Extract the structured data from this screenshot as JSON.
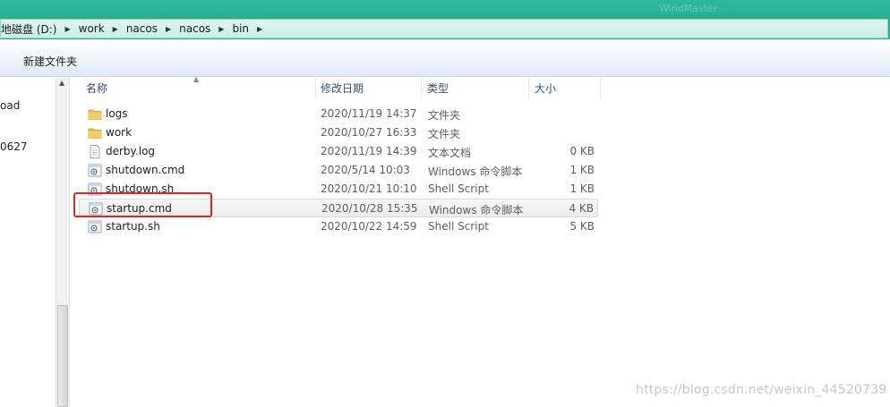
{
  "titlebar": {
    "ghost_text": "WindMaster"
  },
  "address": {
    "crumbs": [
      {
        "label": "地磁盘 (D:)"
      },
      {
        "label": "work"
      },
      {
        "label": "nacos"
      },
      {
        "label": "nacos"
      },
      {
        "label": "bin"
      }
    ]
  },
  "toolbar": {
    "new_folder_label": "新建文件夹"
  },
  "nav": {
    "items": [
      {
        "label": "oad"
      },
      {
        "label": "0627"
      }
    ]
  },
  "columns": {
    "name": "名称",
    "date": "修改日期",
    "type": "类型",
    "size": "大小"
  },
  "files": [
    {
      "name": "logs",
      "date": "2020/11/19 14:37",
      "type": "文件夹",
      "size": "",
      "icon": "folder-icon"
    },
    {
      "name": "work",
      "date": "2020/10/27 16:33",
      "type": "文件夹",
      "size": "",
      "icon": "folder-icon"
    },
    {
      "name": "derby.log",
      "date": "2020/11/19 14:39",
      "type": "文本文档",
      "size": "0 KB",
      "icon": "text-file-icon"
    },
    {
      "name": "shutdown.cmd",
      "date": "2020/5/14 10:03",
      "type": "Windows 命令脚本",
      "size": "1 KB",
      "icon": "script-file-icon"
    },
    {
      "name": "shutdown.sh",
      "date": "2020/10/21 10:10",
      "type": "Shell Script",
      "size": "1 KB",
      "icon": "script-file-icon"
    },
    {
      "name": "startup.cmd",
      "date": "2020/10/28 15:35",
      "type": "Windows 命令脚本",
      "size": "4 KB",
      "icon": "script-file-icon",
      "selected": true
    },
    {
      "name": "startup.sh",
      "date": "2020/10/22 14:59",
      "type": "Shell Script",
      "size": "5 KB",
      "icon": "script-file-icon"
    }
  ],
  "colors": {
    "title_bar": "#2aae92",
    "highlight": "#e3261c",
    "folder": "#e8b84a"
  },
  "watermark": "https://blog.csdn.net/weixin_44520739"
}
